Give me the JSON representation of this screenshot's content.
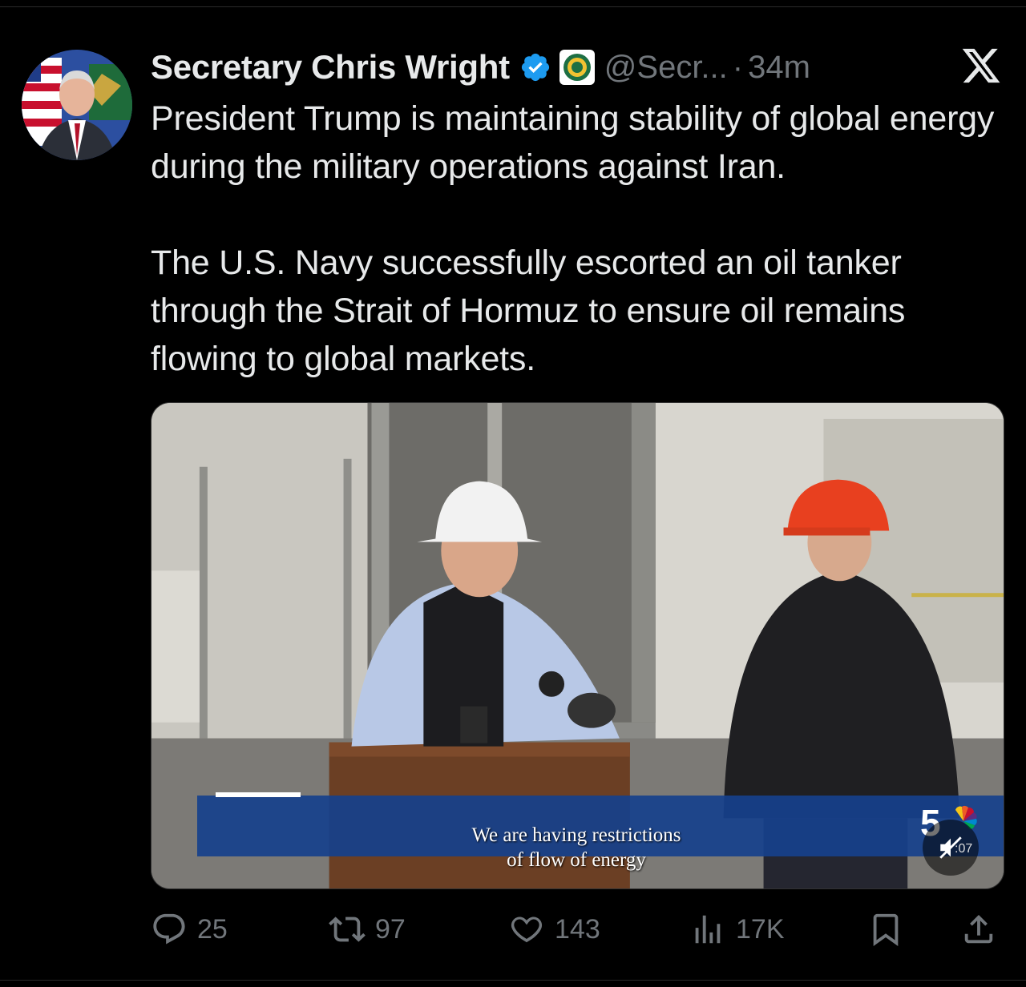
{
  "tweet": {
    "author_name": "Secretary Chris Wright",
    "handle": "@Secr...",
    "separator": "·",
    "time": "34m",
    "paragraphs": [
      "President Trump is maintaining stability of global energy during the military operations against Iran.",
      "The U.S. Navy successfully escorted an oil tanker through the Strait of Hormuz to ensure oil remains flowing to global markets."
    ]
  },
  "media": {
    "caption_line1": "We are having restrictions",
    "caption_line2": "of flow of energy",
    "duration": ":07",
    "caption_bar_color": "#16408c"
  },
  "actions": {
    "replies": "25",
    "reposts": "97",
    "likes": "143",
    "views": "17K"
  },
  "icons": {
    "verified": "verified-badge-icon",
    "affiliation": "doe-seal-icon",
    "close": "x-logo-icon",
    "reply": "reply-icon",
    "repost": "repost-icon",
    "like": "heart-icon",
    "views": "views-icon",
    "bookmark": "bookmark-icon",
    "share": "share-icon",
    "mute": "muted-speaker-icon"
  },
  "colors": {
    "background": "#000000",
    "text": "#e7e9ea",
    "muted": "#71767b",
    "verified": "#1d9bf0"
  }
}
